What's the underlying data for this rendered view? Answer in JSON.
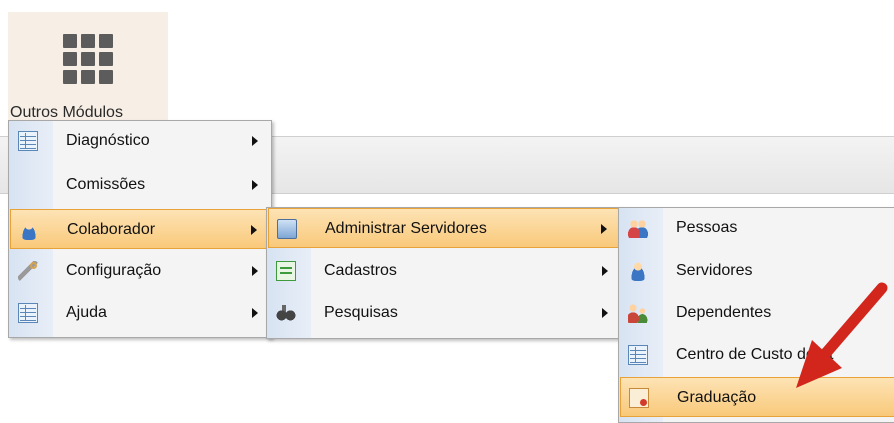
{
  "launcher": {
    "label": "Outros Módulos",
    "icon": "grid-icon"
  },
  "menu_main": [
    {
      "label": "Diagnóstico",
      "icon": "table-icon",
      "has_submenu": true
    },
    {
      "label": "Comissões",
      "icon": "",
      "has_submenu": true
    },
    {
      "label": "Colaborador",
      "icon": "person-icon",
      "has_submenu": true,
      "active": true
    },
    {
      "label": "Configuração",
      "icon": "wrench-icon",
      "has_submenu": true
    },
    {
      "label": "Ajuda",
      "icon": "table-icon",
      "has_submenu": true
    }
  ],
  "menu_colaborador": [
    {
      "label": "Administrar Servidores",
      "icon": "screen-icon",
      "has_submenu": true,
      "active": true
    },
    {
      "label": "Cadastros",
      "icon": "form-icon",
      "has_submenu": true
    },
    {
      "label": "Pesquisas",
      "icon": "binocular-icon",
      "has_submenu": true
    }
  ],
  "menu_administrar": [
    {
      "label": "Pessoas",
      "icon": "people-icon"
    },
    {
      "label": "Servidores",
      "icon": "person-icon"
    },
    {
      "label": "Dependentes",
      "icon": "family-icon"
    },
    {
      "label": "Centro de Custo de At",
      "icon": "table-icon"
    },
    {
      "label": "Graduação",
      "icon": "certificate-icon",
      "active": true
    }
  ],
  "colors": {
    "active_bg": "#f9c97a",
    "active_border": "#e7a33a",
    "annotation_arrow": "#d2261c"
  }
}
